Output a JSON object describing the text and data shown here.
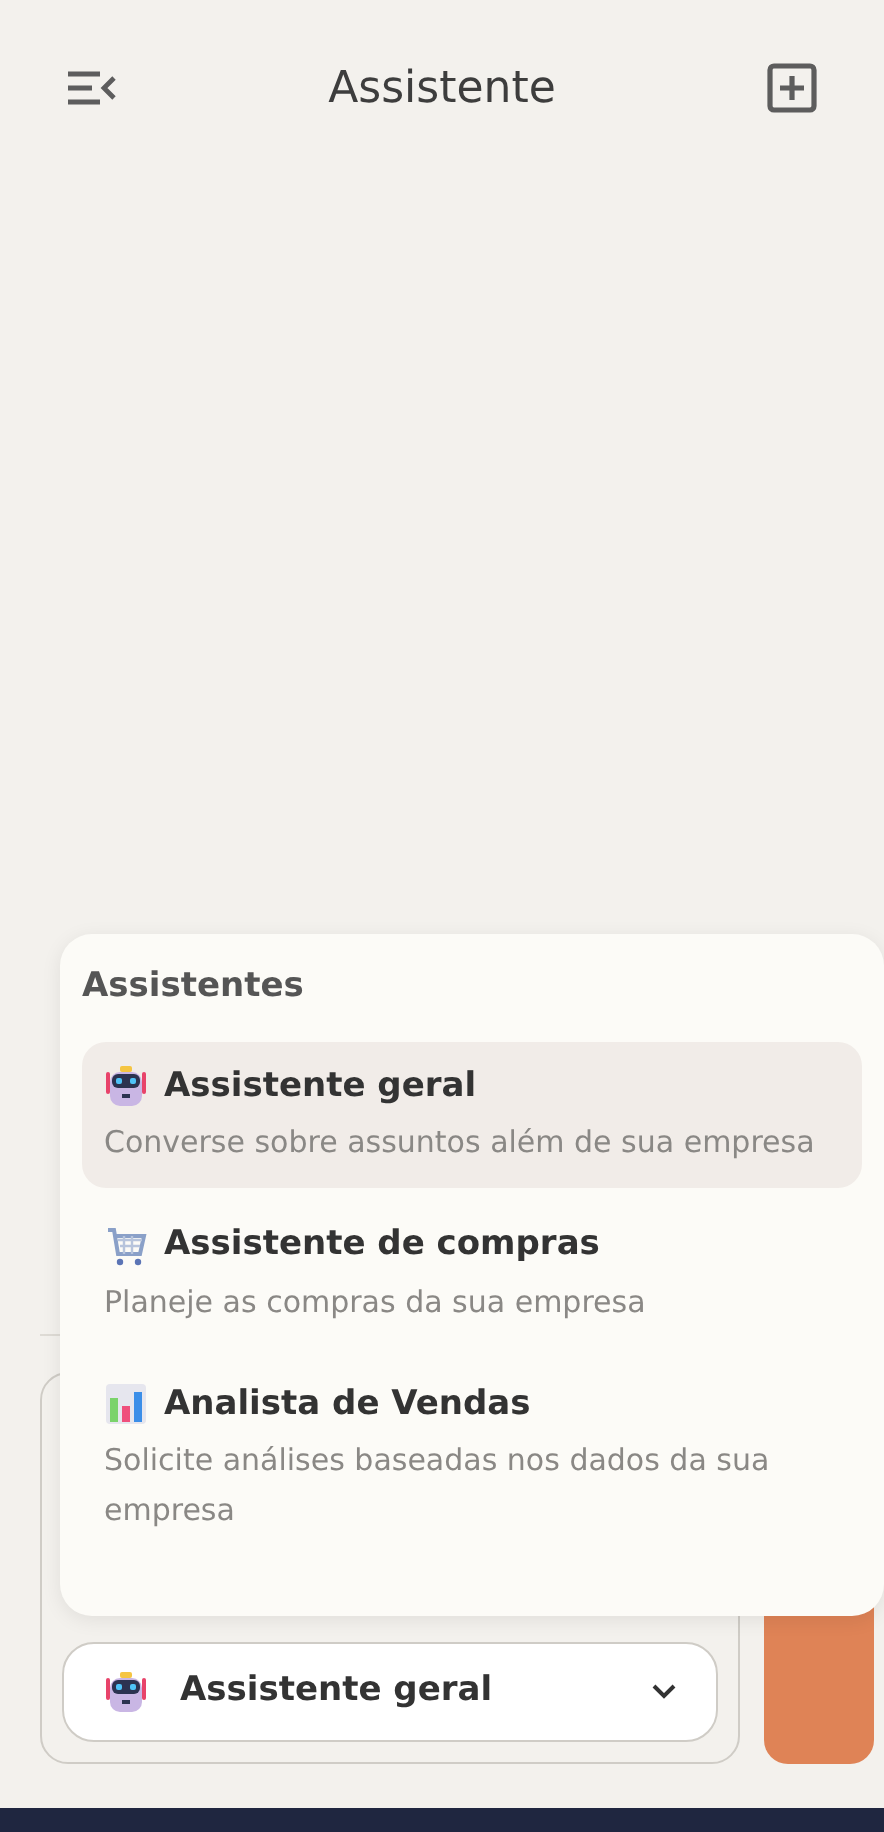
{
  "header": {
    "title": "Assistente"
  },
  "menu": {
    "title": "Assistentes",
    "items": [
      {
        "kind": "robot",
        "label": "Assistente geral",
        "description": "Converse sobre assuntos além de sua empresa",
        "selected": true
      },
      {
        "kind": "cart",
        "label": "Assistente de compras",
        "description": "Planeje as compras da sua empresa",
        "selected": false
      },
      {
        "kind": "chart",
        "label": "Analista de Vendas",
        "description": "Solicite análises baseadas nos dados da sua empresa",
        "selected": false
      }
    ]
  },
  "selector": {
    "kind": "robot",
    "value": "Assistente geral"
  }
}
